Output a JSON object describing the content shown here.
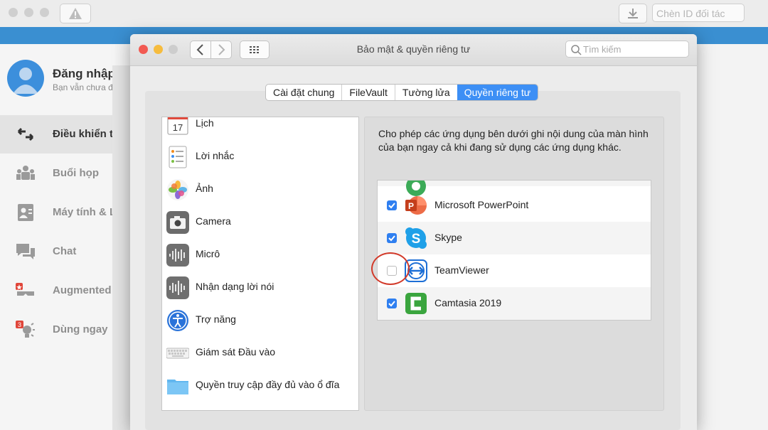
{
  "bg_app": {
    "partner_placeholder": "Chèn ID đối tác",
    "login_title": "Đăng nhập",
    "login_subtitle": "Bạn vẫn chưa đ",
    "nav": [
      {
        "label": "Điều khiển t",
        "icon": "arrows-icon",
        "active": true
      },
      {
        "label": "Buổi họp",
        "icon": "people-icon",
        "active": false
      },
      {
        "label": "Máy tính & L",
        "icon": "contact-card-icon",
        "active": false
      },
      {
        "label": "Chat",
        "icon": "chat-bubbles-icon",
        "active": false
      },
      {
        "label": "Augmented",
        "icon": "ar-glasses-icon",
        "active": false
      },
      {
        "label": "Dùng ngay",
        "icon": "lightbulb-icon",
        "badge": "3",
        "active": false
      }
    ]
  },
  "prefs": {
    "title": "Bảo mật & quyền riêng tư",
    "search_placeholder": "Tìm kiếm",
    "tabs": [
      {
        "label": "Cài đặt chung",
        "selected": false
      },
      {
        "label": "FileVault",
        "selected": false
      },
      {
        "label": "Tường lửa",
        "selected": false
      },
      {
        "label": "Quyền riêng tư",
        "selected": true
      }
    ],
    "categories": [
      {
        "label": "Lịch",
        "icon": "calendar-icon",
        "day": "17"
      },
      {
        "label": "Lời nhắc",
        "icon": "reminders-icon"
      },
      {
        "label": "Ảnh",
        "icon": "photos-icon"
      },
      {
        "label": "Camera",
        "icon": "camera-icon"
      },
      {
        "label": "Micrô",
        "icon": "microphone-icon"
      },
      {
        "label": "Nhận dạng lời nói",
        "icon": "speech-recognition-icon"
      },
      {
        "label": "Trợ năng",
        "icon": "accessibility-icon"
      },
      {
        "label": "Giám sát Đầu vào",
        "icon": "keyboard-icon"
      },
      {
        "label": "Quyền truy cập đầy đủ vào ổ đĩa",
        "icon": "folder-icon"
      }
    ],
    "description": "Cho phép các ứng dụng bên dưới ghi nội dung của màn hình của bạn ngay cả khi đang sử dụng các ứng dụng khác.",
    "apps": [
      {
        "label": "Microsoft PowerPoint",
        "checked": true,
        "icon": "powerpoint-icon"
      },
      {
        "label": "Skype",
        "checked": true,
        "icon": "skype-icon"
      },
      {
        "label": "TeamViewer",
        "checked": false,
        "icon": "teamviewer-icon"
      },
      {
        "label": "Camtasia 2019",
        "checked": true,
        "icon": "camtasia-icon"
      }
    ],
    "colors": {
      "accent": "#3d8ff5",
      "checkbox": "#2f7ff0",
      "annotation": "#d23a2a"
    }
  }
}
